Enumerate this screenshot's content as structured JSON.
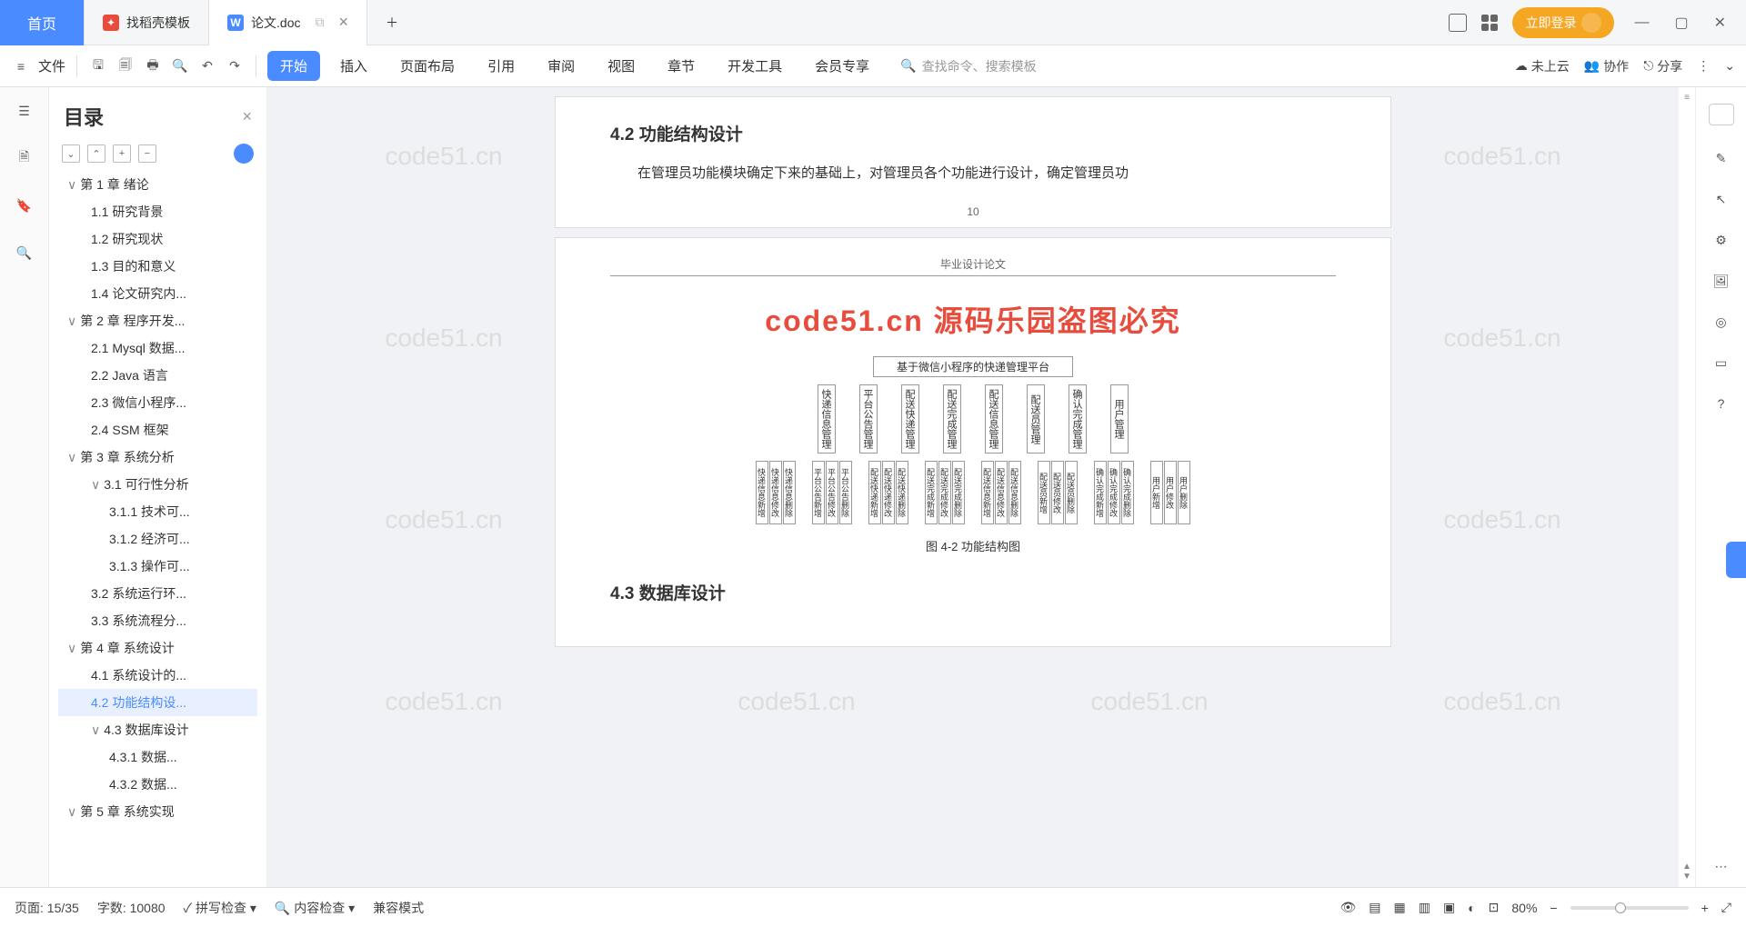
{
  "tabs": {
    "home": "首页",
    "template": "找稻壳模板",
    "doc": "论文.doc"
  },
  "top_right": {
    "login": "立即登录"
  },
  "file_label": "文件",
  "menu": [
    "开始",
    "插入",
    "页面布局",
    "引用",
    "审阅",
    "视图",
    "章节",
    "开发工具",
    "会员专享"
  ],
  "search_placeholder": "查找命令、搜索模板",
  "ribbon_right": {
    "cloud": "未上云",
    "collab": "协作",
    "share": "分享"
  },
  "toc": {
    "title": "目录",
    "items": [
      {
        "lvl": 1,
        "t": "第 1 章 绪论",
        "chev": "∨"
      },
      {
        "lvl": 2,
        "t": "1.1 研究背景"
      },
      {
        "lvl": 2,
        "t": "1.2 研究现状"
      },
      {
        "lvl": 2,
        "t": "1.3 目的和意义"
      },
      {
        "lvl": 2,
        "t": "1.4 论文研究内..."
      },
      {
        "lvl": 1,
        "t": "第 2 章 程序开发...",
        "chev": "∨"
      },
      {
        "lvl": 2,
        "t": "2.1 Mysql 数据..."
      },
      {
        "lvl": 2,
        "t": "2.2 Java 语言"
      },
      {
        "lvl": 2,
        "t": "2.3 微信小程序..."
      },
      {
        "lvl": 2,
        "t": "2.4 SSM 框架"
      },
      {
        "lvl": 1,
        "t": "第 3 章 系统分析",
        "chev": "∨"
      },
      {
        "lvl": 2,
        "t": "3.1 可行性分析",
        "chev": "∨"
      },
      {
        "lvl": 3,
        "t": "3.1.1 技术可..."
      },
      {
        "lvl": 3,
        "t": "3.1.2 经济可..."
      },
      {
        "lvl": 3,
        "t": "3.1.3 操作可..."
      },
      {
        "lvl": 2,
        "t": "3.2 系统运行环..."
      },
      {
        "lvl": 2,
        "t": "3.3 系统流程分..."
      },
      {
        "lvl": 1,
        "t": "第 4 章 系统设计",
        "chev": "∨"
      },
      {
        "lvl": 2,
        "t": "4.1 系统设计的..."
      },
      {
        "lvl": 2,
        "t": "4.2 功能结构设...",
        "active": true
      },
      {
        "lvl": 2,
        "t": "4.3 数据库设计",
        "chev": "∨"
      },
      {
        "lvl": 3,
        "t": "4.3.1 数据..."
      },
      {
        "lvl": 3,
        "t": "4.3.2 数据..."
      },
      {
        "lvl": 1,
        "t": "第 5 章 系统实现",
        "chev": "∨"
      }
    ]
  },
  "doc": {
    "sec42": "4.2 功能结构设计",
    "para42": "在管理员功能模块确定下来的基础上，对管理员各个功能进行设计，确定管理员功",
    "pagenum": "10",
    "p2_header": "毕业设计论文",
    "red_wm": "code51.cn 源码乐园盗图必究",
    "bg_wm": "code51.cn",
    "diagram_title": "基于微信小程序的快递管理平台",
    "dia_nodes": [
      "快递信息管理",
      "平台公告管理",
      "配送快递管理",
      "配送完成管理",
      "配送信息管理",
      "配送员管理",
      "确认完成管理",
      "用户管理"
    ],
    "dia_leaf_groups": [
      [
        "快递信息新增",
        "快递信息修改",
        "快递信息删除"
      ],
      [
        "平台公告新增",
        "平台公告修改",
        "平台公告删除"
      ],
      [
        "配送快递新增",
        "配送快递修改",
        "配送快递删除"
      ],
      [
        "配送完成新增",
        "配送完成修改",
        "配送完成删除"
      ],
      [
        "配送信息新增",
        "配送信息修改",
        "配送信息删除"
      ],
      [
        "配送员新增",
        "配送员修改",
        "配送员删除"
      ],
      [
        "确认完成新增",
        "确认完成修改",
        "确认完成删除"
      ],
      [
        "用户新增",
        "用户修改",
        "用户删除"
      ]
    ],
    "dia_caption": "图 4-2 功能结构图",
    "sec43": "4.3 数据库设计"
  },
  "status": {
    "page": "页面: 15/35",
    "words": "字数: 10080",
    "spell": "拼写检查",
    "content": "内容检查",
    "compat": "兼容模式",
    "zoom": "80%"
  }
}
